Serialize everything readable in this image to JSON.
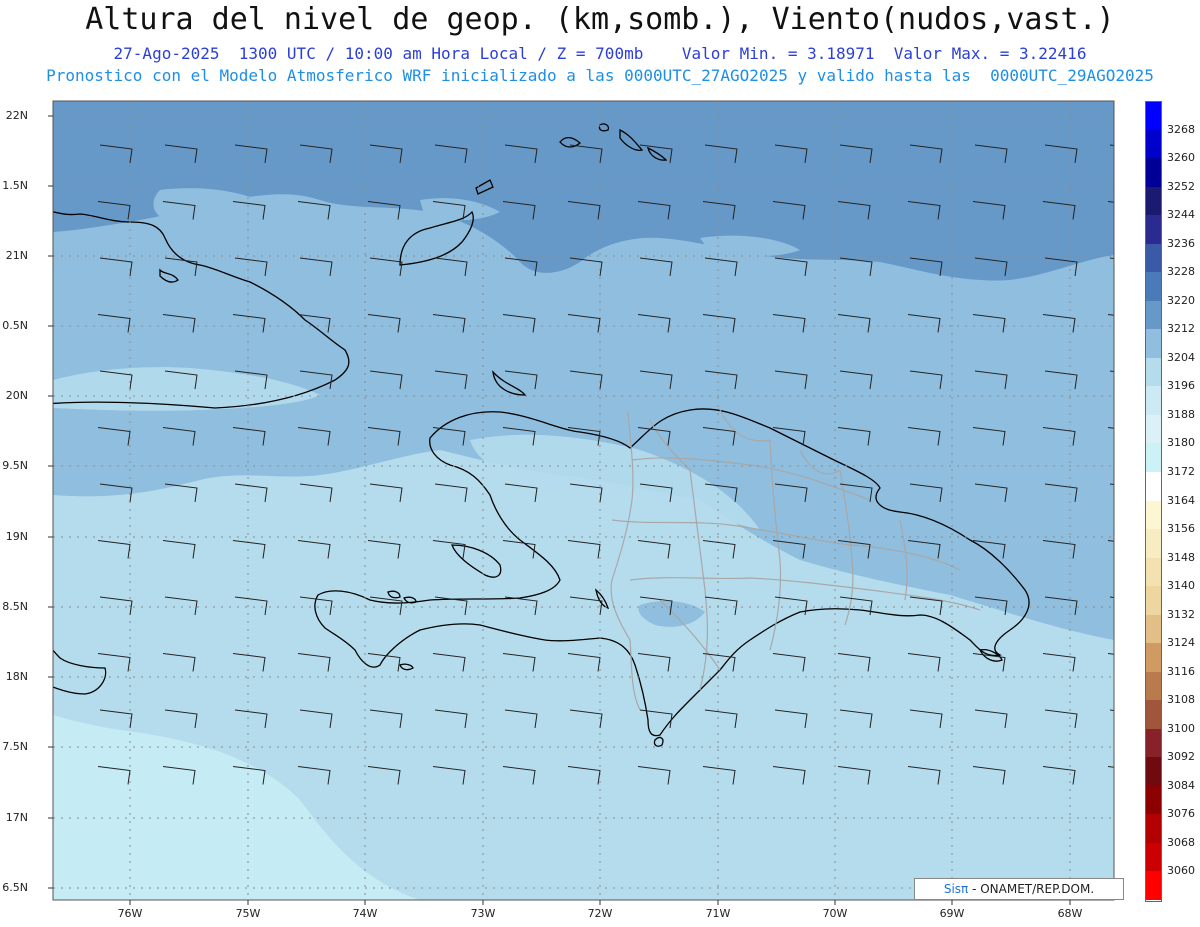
{
  "header": {
    "title": "Altura del nivel de geop. (km,somb.), Viento(nudos,vast.)",
    "line1": "27-Ago-2025  1300 UTC / 10:00 am Hora Local / Z = 700mb    Valor Min. = 3.18971  Valor Max. = 3.22416",
    "line2": "Pronostico con el Modelo Atmosferico WRF inicializado a las 0000UTC_27AGO2025 y valido hasta las  0000UTC_29AGO2025"
  },
  "axes": {
    "lat_labels": [
      "22N",
      "1.5N",
      "21N",
      "0.5N",
      "20N",
      "9.5N",
      "19N",
      "8.5N",
      "18N",
      "7.5N",
      "17N",
      "6.5N"
    ],
    "lon_labels": [
      "76W",
      "75W",
      "74W",
      "73W",
      "72W",
      "71W",
      "70W",
      "69W",
      "68W"
    ]
  },
  "legend": {
    "labels": [
      "3268",
      "3260",
      "3252",
      "3244",
      "3236",
      "3228",
      "3220",
      "3212",
      "3204",
      "3196",
      "3188",
      "3180",
      "3172",
      "3164",
      "3156",
      "3148",
      "3140",
      "3132",
      "3124",
      "3116",
      "3108",
      "3100",
      "3092",
      "3084",
      "3076",
      "3068",
      "3060"
    ],
    "colors": [
      "#0000ff",
      "#0000cc",
      "#000099",
      "#1a1a70",
      "#2a2a90",
      "#3a5aa8",
      "#4a7ab8",
      "#6699c8",
      "#8fbede",
      "#b5dced",
      "#cdeaf4",
      "#dcf0f8",
      "#ccf2f6",
      "#ffffff",
      "#fdf6d2",
      "#f7ecc2",
      "#f3e2b0",
      "#eed6a0",
      "#e2bf86",
      "#cf9b62",
      "#b97a4c",
      "#a0563a",
      "#88222a",
      "#6e0a10",
      "#8c0000",
      "#b30000",
      "#cc0000",
      "#ff0000"
    ]
  },
  "credit": {
    "brand": "Sisπ",
    "text": " - ONAMET/REP.DOM."
  },
  "colors": {
    "deep": "#6699c8",
    "mid": "#8fbede",
    "light": "#b5dced",
    "pale": "#c5ebf4",
    "coast": "#000000",
    "borders": "#a8a8a8",
    "grid": "#8a8a8a",
    "barb": "#222222"
  }
}
